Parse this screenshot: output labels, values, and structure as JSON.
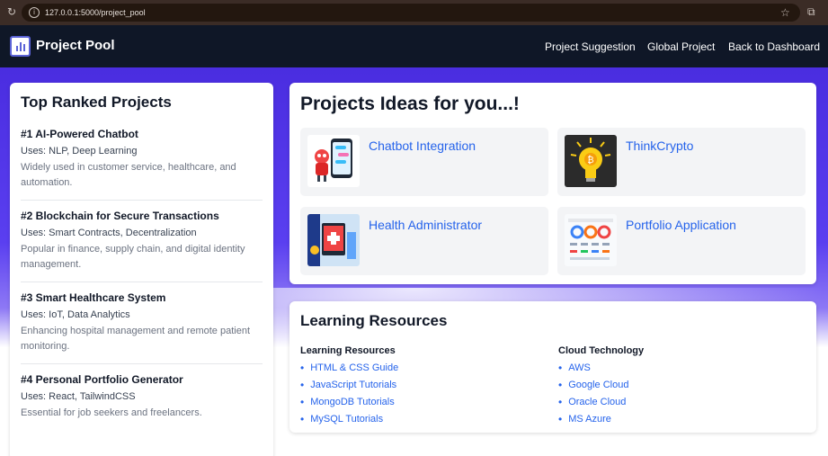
{
  "browser": {
    "url": "127.0.0.1:5000/project_pool"
  },
  "nav": {
    "brand": "Project Pool",
    "links": [
      "Project Suggestion",
      "Global Project",
      "Back to Dashboard"
    ]
  },
  "top_ranked": {
    "title": "Top Ranked Projects",
    "items": [
      {
        "title": "#1 AI-Powered Chatbot",
        "uses": "Uses: NLP, Deep Learning",
        "desc": "Widely used in customer service, healthcare, and automation."
      },
      {
        "title": "#2 Blockchain for Secure Transactions",
        "uses": "Uses: Smart Contracts, Decentralization",
        "desc": "Popular in finance, supply chain, and digital identity management."
      },
      {
        "title": "#3 Smart Healthcare System",
        "uses": "Uses: IoT, Data Analytics",
        "desc": "Enhancing hospital management and remote patient monitoring."
      },
      {
        "title": "#4 Personal Portfolio Generator",
        "uses": "Uses: React, TailwindCSS",
        "desc": "Essential for job seekers and freelancers."
      }
    ]
  },
  "ideas": {
    "title": "Projects Ideas for you...!",
    "items": [
      {
        "name": "Chatbot Integration",
        "icon": "chatbot-illustration"
      },
      {
        "name": "ThinkCrypto",
        "icon": "bitcoin-bulb-illustration"
      },
      {
        "name": "Health Administrator",
        "icon": "health-admin-illustration"
      },
      {
        "name": "Portfolio Application",
        "icon": "dashboard-illustration"
      }
    ]
  },
  "resources": {
    "title": "Learning Resources",
    "columns": [
      {
        "title": "Learning Resources",
        "links": [
          "HTML & CSS Guide",
          "JavaScript Tutorials",
          "MongoDB Tutorials",
          "MySQL Tutorials"
        ]
      },
      {
        "title": "Cloud Technology",
        "links": [
          "AWS",
          "Google Cloud",
          "Oracle Cloud",
          "MS Azure"
        ]
      }
    ]
  }
}
